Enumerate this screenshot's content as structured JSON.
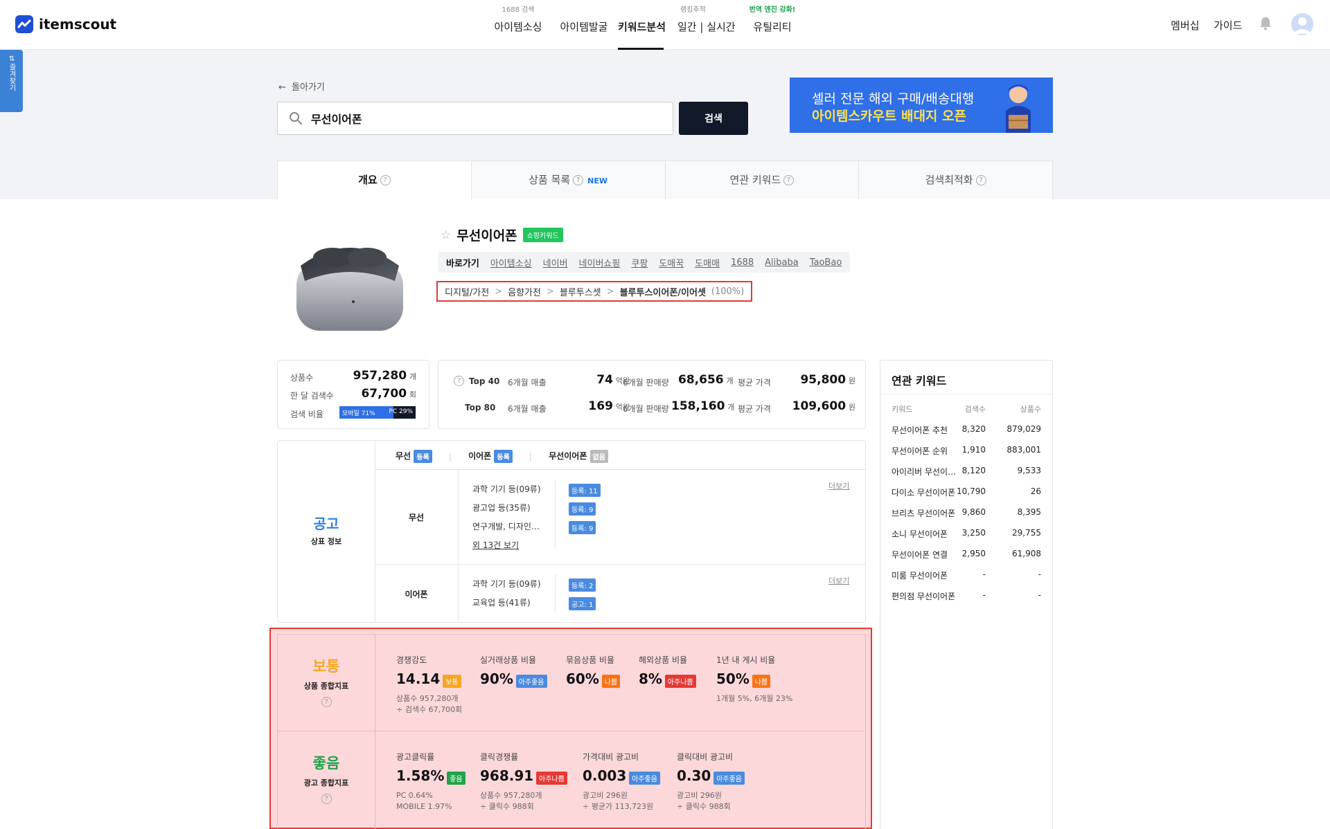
{
  "header": {
    "logo": "itemscout",
    "nav": [
      {
        "sub": "1688 검색",
        "label": "아이템소싱"
      },
      {
        "sub": "",
        "label": "아이템발굴"
      },
      {
        "sub": "",
        "label": "키워드분석"
      },
      {
        "sub": "랭킹추적",
        "label": "일간 | 실시간"
      },
      {
        "sub": "번역 엔진 강화!",
        "label": "유틸리티"
      }
    ],
    "membership": "멤버십",
    "guide": "가이드"
  },
  "fav": "⇄ 즐겨찾기",
  "back": "돌아가기",
  "search": {
    "value": "무선이어폰",
    "button": "검색"
  },
  "banner": {
    "line1": "셀러 전문 해외 구매/배송대행",
    "line2": "아이템스카우트 배대지 오픈"
  },
  "tabs": [
    {
      "label": "개요"
    },
    {
      "label": "상품 목록",
      "badge": "NEW"
    },
    {
      "label": "연관 키워드"
    },
    {
      "label": "검색최적화"
    }
  ],
  "keyword": {
    "name": "무선이어폰",
    "badge": "쇼핑키워드",
    "shortcut_label": "바로가기",
    "shortcuts": [
      "아이템소싱",
      "네이버",
      "네이버쇼핑",
      "쿠팡",
      "도매꾹",
      "도매매",
      "1688",
      "Alibaba",
      "TaoBao"
    ],
    "category": [
      "디지털/가전",
      "음향가전",
      "블루투스셋",
      "블루투스이어폰/이어셋"
    ],
    "category_sep": ">",
    "category_pct": "(100%)"
  },
  "summary": {
    "products_label": "상품수",
    "products": "957,280",
    "products_unit": "개",
    "search_label": "한 달 검색수",
    "search": "67,700",
    "search_unit": "회",
    "ratio_label": "검색 비율",
    "mobile": "모바일 71%",
    "pc": "PC 29%",
    "mobile_ratio": 0.71
  },
  "top": [
    {
      "label": "Top 40",
      "rev_label": "6개월 매출",
      "rev": "74",
      "rev_unit": "억원",
      "sales_label": "6개월 판매량",
      "sales": "68,656",
      "sales_unit": "개",
      "price_label": "평균 가격",
      "price": "95,800",
      "price_unit": "원"
    },
    {
      "label": "Top 80",
      "rev_label": "6개월 매출",
      "rev": "169",
      "rev_unit": "억원",
      "sales_label": "6개월 판매량",
      "sales": "158,160",
      "sales_unit": "개",
      "price_label": "평균 가격",
      "price": "109,600",
      "price_unit": "원"
    }
  ],
  "trademark": {
    "title": "공고",
    "subtitle": "상표 정보",
    "words": [
      {
        "w": "무선",
        "tag": "등록"
      },
      {
        "w": "이어폰",
        "tag": "등록"
      },
      {
        "w": "무선이어폰",
        "tag": "없음"
      }
    ],
    "more": "더보기",
    "groups": [
      {
        "word": "무선",
        "rows": [
          {
            "cls": "과학 기기 등(09류)",
            "tag": "등록: 11"
          },
          {
            "cls": "광고업 등(35류)",
            "tag": "등록: 9"
          },
          {
            "cls": "연구개발, 디자인…",
            "tag": "등록: 9"
          }
        ],
        "extra": "외 13건 보기"
      },
      {
        "word": "이어폰",
        "rows": [
          {
            "cls": "과학 기기 등(09류)",
            "tag": "등록: 2"
          },
          {
            "cls": "교육업 등(41류)",
            "tag": "공고: 1"
          }
        ]
      }
    ]
  },
  "product_index": {
    "grade": "보통",
    "title": "상품 종합지표",
    "items": [
      {
        "label": "경쟁강도",
        "value": "14.14",
        "tag": "보통",
        "sub1": "상품수 957,280개",
        "sub2": "÷ 검색수 67,700회"
      },
      {
        "label": "실거래상품 비율",
        "value": "90%",
        "tag": "아주좋음",
        "sub1": "",
        "sub2": ""
      },
      {
        "label": "묶음상품 비율",
        "value": "60%",
        "tag": "나쁨",
        "sub1": "",
        "sub2": ""
      },
      {
        "label": "해외상품 비율",
        "value": "8%",
        "tag": "아주나쁨",
        "sub1": "",
        "sub2": ""
      },
      {
        "label": "1년 내 게시 비율",
        "value": "50%",
        "tag": "나쁨",
        "sub1": "1개월 5%, 6개월 23%",
        "sub2": ""
      }
    ]
  },
  "ad_index": {
    "grade": "좋음",
    "title": "광고 종합지표",
    "items": [
      {
        "label": "광고클릭률",
        "value": "1.58%",
        "tag": "좋음",
        "sub1": "PC 0.64%",
        "sub2": "MOBILE 1.97%"
      },
      {
        "label": "클릭경쟁률",
        "value": "968.91",
        "tag": "아주나쁨",
        "sub1": "상품수 957,280개",
        "sub2": "÷ 클릭수 988회"
      },
      {
        "label": "가격대비 광고비",
        "value": "0.003",
        "tag": "아주좋음",
        "sub1": "광고비 296원",
        "sub2": "÷ 평균가 113,723원"
      },
      {
        "label": "클릭대비 광고비",
        "value": "0.30",
        "tag": "아주좋음",
        "sub1": "광고비 296원",
        "sub2": "÷ 클릭수 988회"
      }
    ]
  },
  "related": {
    "title": "연관 키워드",
    "headers": [
      "키워드",
      "검색수",
      "상품수"
    ],
    "rows": [
      [
        "무선이어폰 추천",
        "8,320",
        "879,029"
      ],
      [
        "무선이어폰 순위",
        "1,910",
        "883,001"
      ],
      [
        "아이리버 무선이…",
        "8,120",
        "9,533"
      ],
      [
        "다이소 무선이어폰",
        "10,790",
        "26"
      ],
      [
        "브리츠 무선이어폰",
        "9,860",
        "8,395"
      ],
      [
        "소니 무선이어폰",
        "3,250",
        "29,755"
      ],
      [
        "무선이어폰 연결",
        "2,950",
        "61,908"
      ],
      [
        "미룸 무선이어폰",
        "-",
        "-"
      ],
      [
        "편의점 무선이어폰",
        "-",
        "-"
      ]
    ]
  },
  "colors": {
    "accent": "#1f4fd6",
    "highlight": "#e53935",
    "highlight_bg": "#fdd8db",
    "good": "#22a34a",
    "normal": "#f5a623",
    "ad_blue": "#2f6fe7"
  }
}
